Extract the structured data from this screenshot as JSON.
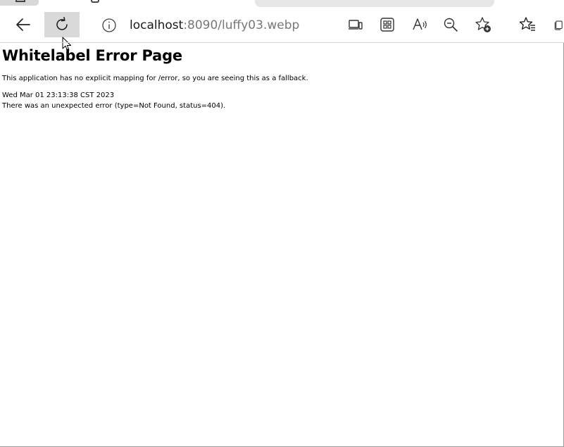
{
  "browser": {
    "address": {
      "host": "localhost",
      "rest": ":8090/luffy03.webp"
    },
    "toolbar": {
      "back_icon": "arrow-left-icon",
      "refresh_icon": "refresh-icon",
      "site_info_icon": "info-circle-icon",
      "icons_right": [
        "device-icon",
        "apps-icon",
        "read-aloud-icon",
        "zoom-out-icon",
        "add-favorite-icon",
        "favorites-icon"
      ]
    }
  },
  "page": {
    "title": "Whitelabel Error Page",
    "description": "This application has no explicit mapping for /error, so you are seeing this as a fallback.",
    "timestamp": "Wed Mar 01 23:13:38 CST 2023",
    "error_message": "There was an unexpected error (type=Not Found, status=404)."
  }
}
